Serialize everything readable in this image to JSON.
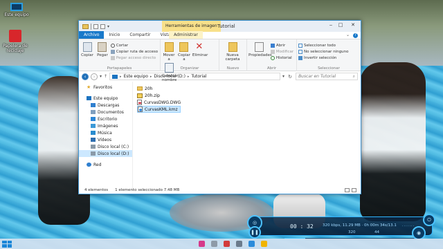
{
  "desktop": {
    "icons": [
      {
        "label": "Este equipo"
      },
      {
        "label": "Papelera de reciclaje"
      }
    ]
  },
  "window": {
    "title": "Tutorial",
    "contextual_tab": "Herramientas de imagen",
    "tabs": [
      "Archivo",
      "Inicio",
      "Compartir",
      "Vista",
      "Administrar"
    ],
    "ribbon": {
      "portapapeles": {
        "label": "Portapapeles",
        "copiar": "Copiar",
        "pegar": "Pegar",
        "cortar": "Cortar",
        "copiar_ruta": "Copiar ruta de acceso",
        "pegar_acceso": "Pegar acceso directo"
      },
      "organizar": {
        "label": "Organizar",
        "mover": "Mover a",
        "copiar": "Copiar a",
        "eliminar": "Eliminar",
        "cambiar": "Cambiar nombre"
      },
      "nuevo": {
        "label": "Nuevo",
        "nueva_carpeta": "Nueva carpeta"
      },
      "abrir": {
        "label": "Abrir",
        "propiedades": "Propiedades",
        "abrir": "Abrir",
        "modificar": "Modificar",
        "historial": "Historial"
      },
      "seleccionar": {
        "label": "Seleccionar",
        "todo": "Seleccionar todo",
        "ninguno": "No seleccionar ninguno",
        "invertir": "Invertir selección"
      }
    },
    "address": {
      "crumbs": [
        "Este equipo",
        "Disco local (D:)",
        "Tutorial"
      ],
      "search_placeholder": "Buscar en Tutorial"
    },
    "nav": {
      "favoritos": "Favoritos",
      "este_equipo": "Este equipo",
      "items": [
        "Descargas",
        "Documentos",
        "Escritorio",
        "Imágenes",
        "Música",
        "Vídeos",
        "Disco local (C:)",
        "Disco local (D:)"
      ],
      "red": "Red"
    },
    "files": [
      {
        "name": "20h",
        "type": "folder"
      },
      {
        "name": "20h.zip",
        "type": "zip"
      },
      {
        "name": "CurvasDWG.DWG",
        "type": "dwg"
      },
      {
        "name": "CurvasKML.kmz",
        "type": "kmz",
        "selected": true
      }
    ],
    "status": {
      "count": "4 elementos",
      "selection": "1 elemento seleccionado  7.48 MB"
    }
  },
  "player": {
    "time": "00 : 32",
    "info": "320 kbps, 11.29 MB · 0h 00m 34s/13.1",
    "num1": "320",
    "num2": "44",
    "progress": 0.15
  },
  "colors": {
    "accent": "#1979ca",
    "contextual": "#f8e08a",
    "selection": "#cce8ff"
  }
}
